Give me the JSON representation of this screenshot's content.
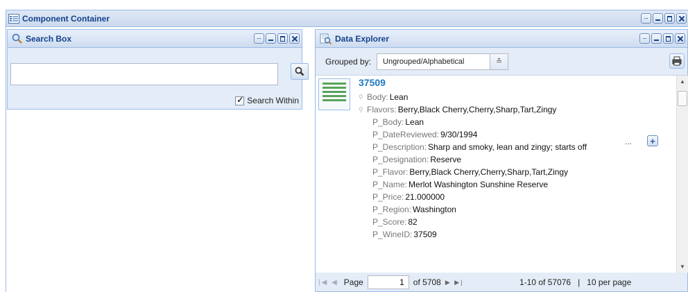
{
  "container": {
    "title": "Component Container"
  },
  "search_box": {
    "title": "Search Box",
    "query": "",
    "search_within_label": "Search Within",
    "search_within_checked": true
  },
  "explorer": {
    "title": "Data Explorer",
    "grouped_by_label": "Grouped by:",
    "grouped_by_value": "Ungrouped/Alphabetical",
    "record": {
      "title": "37509",
      "pinned_fields": [
        {
          "key": "Body:",
          "value": "Lean"
        },
        {
          "key": "Flavors:",
          "value": "Berry,Black Cherry,Cherry,Sharp,Tart,Zingy"
        }
      ],
      "fields": [
        {
          "key": "P_Body:",
          "value": "Lean"
        },
        {
          "key": "P_DateReviewed:",
          "value": "9/30/1994"
        },
        {
          "key": "P_Description:",
          "value": "Sharp and smoky, lean and zingy; starts off"
        },
        {
          "key": "P_Designation:",
          "value": "Reserve"
        },
        {
          "key": "P_Flavor:",
          "value": "Berry,Black Cherry,Cherry,Sharp,Tart,Zingy"
        },
        {
          "key": "P_Name:",
          "value": "Merlot Washington Sunshine Reserve"
        },
        {
          "key": "P_Price:",
          "value": "21.000000"
        },
        {
          "key": "P_Region:",
          "value": "Washington"
        },
        {
          "key": "P_Score:",
          "value": "82"
        },
        {
          "key": "P_WineID:",
          "value": "37509"
        }
      ],
      "ellipsis": "...",
      "expand_label": "+"
    },
    "pager": {
      "page_label": "Page",
      "page_value": "1",
      "of_pages": "of 5708",
      "range_info": "1-10 of 57076   |   10 per page"
    }
  }
}
